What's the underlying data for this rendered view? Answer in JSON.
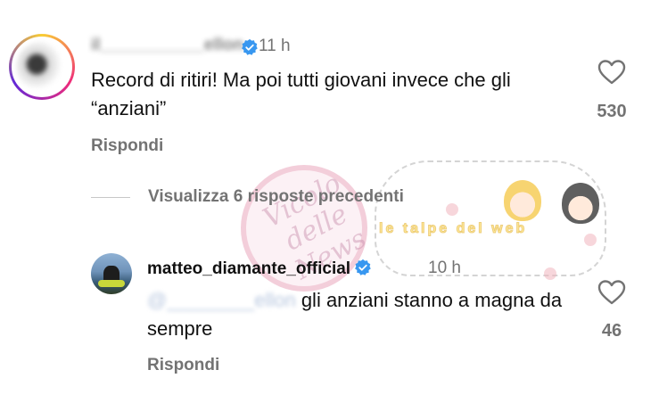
{
  "comments": [
    {
      "username": "il___________ellon",
      "time": "11 h",
      "text": "Record di ritiri! Ma poi tutti giovani invece che gli “anziani”",
      "reply_label": "Rispondi",
      "like_count": "530"
    },
    {
      "username": "matteo_diamante_official",
      "time": "10 h",
      "mention": "@________ellon",
      "text": " gli anziani stanno a magna da sempre",
      "reply_label": "Rispondi",
      "like_count": "46"
    }
  ],
  "view_replies_label": "Visualizza 6 risposte precedenti",
  "watermarks": {
    "script_text": "Vicolo delle News",
    "badge_text": "le talpe del web"
  },
  "colors": {
    "verified": "#3897f0",
    "secondary_text": "#737373",
    "primary_text": "#111111"
  }
}
